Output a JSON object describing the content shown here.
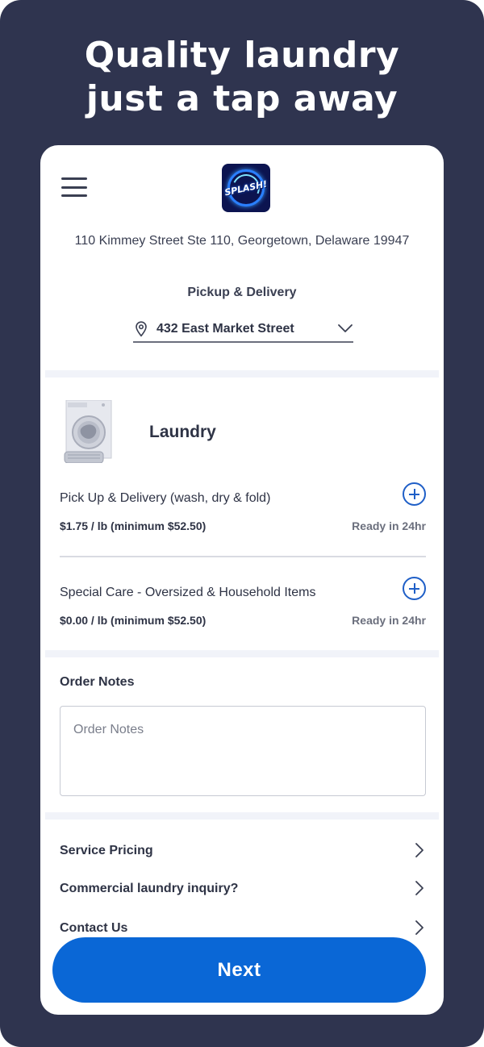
{
  "headline": {
    "line1": "Quality laundry",
    "line2": "just a tap away"
  },
  "header": {
    "logo_text": "SPLASH!",
    "address": "110 Kimmey Street Ste 110, Georgetown, Delaware 19947",
    "service_mode": "Pickup & Delivery",
    "selected_location": "432 East Market Street"
  },
  "category": {
    "title": "Laundry"
  },
  "services": [
    {
      "name": "Pick Up & Delivery (wash, dry & fold)",
      "price": "$1.75 / lb (minimum $52.50)",
      "ready": "Ready in 24hr"
    },
    {
      "name": "Special Care - Oversized & Household Items",
      "price": "$0.00 / lb (minimum $52.50)",
      "ready": "Ready in 24hr"
    }
  ],
  "order_notes": {
    "label": "Order Notes",
    "placeholder": "Order Notes"
  },
  "links": [
    {
      "label": "Service Pricing"
    },
    {
      "label": "Commercial laundry inquiry?"
    },
    {
      "label": "Contact Us"
    }
  ],
  "next_button": {
    "label": "Next"
  },
  "colors": {
    "frame": "#2f344f",
    "primary": "#0a67d6",
    "accent_icon": "#1f5fc7"
  }
}
